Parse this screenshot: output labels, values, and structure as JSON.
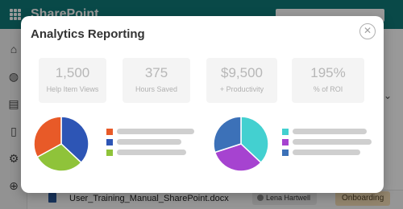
{
  "app": {
    "title": "SharePoint"
  },
  "background_row": {
    "file_name": "User_Training_Manual_SharePoint.docx",
    "user": "Lena Hartwell",
    "tag": "Onboarding"
  },
  "modal": {
    "title": "Analytics Reporting",
    "close_symbol": "✕",
    "stats": [
      {
        "value": "1,500",
        "label": "Help Item Views"
      },
      {
        "value": "375",
        "label": "Hours Saved"
      },
      {
        "value": "$9,500",
        "label": "+ Productivity"
      },
      {
        "value": "195%",
        "label": "% of ROI"
      }
    ]
  },
  "charts": {
    "left_pie": {
      "slices": [
        {
          "value": 37,
          "color": "#2d55b5"
        },
        {
          "value": 30,
          "color": "#8fc33a"
        },
        {
          "value": 33,
          "color": "#e85a28"
        }
      ],
      "legend_colors": [
        "#e85a28",
        "#2d55b5",
        "#8fc33a"
      ]
    },
    "right_pie": {
      "slices": [
        {
          "value": 37,
          "color": "#43d0d0"
        },
        {
          "value": 33,
          "color": "#a643d0"
        },
        {
          "value": 30,
          "color": "#3c71b8"
        }
      ],
      "legend_colors": [
        "#43d0d0",
        "#a643d0",
        "#3c71b8"
      ]
    }
  },
  "icons": {
    "waffle": "app-launcher-icon",
    "rail": [
      "home-icon",
      "globe-icon",
      "contact-card-icon",
      "document-icon",
      "settings-icon",
      "add-icon"
    ],
    "chevron": "chevron-down-icon",
    "close": "close-icon"
  }
}
